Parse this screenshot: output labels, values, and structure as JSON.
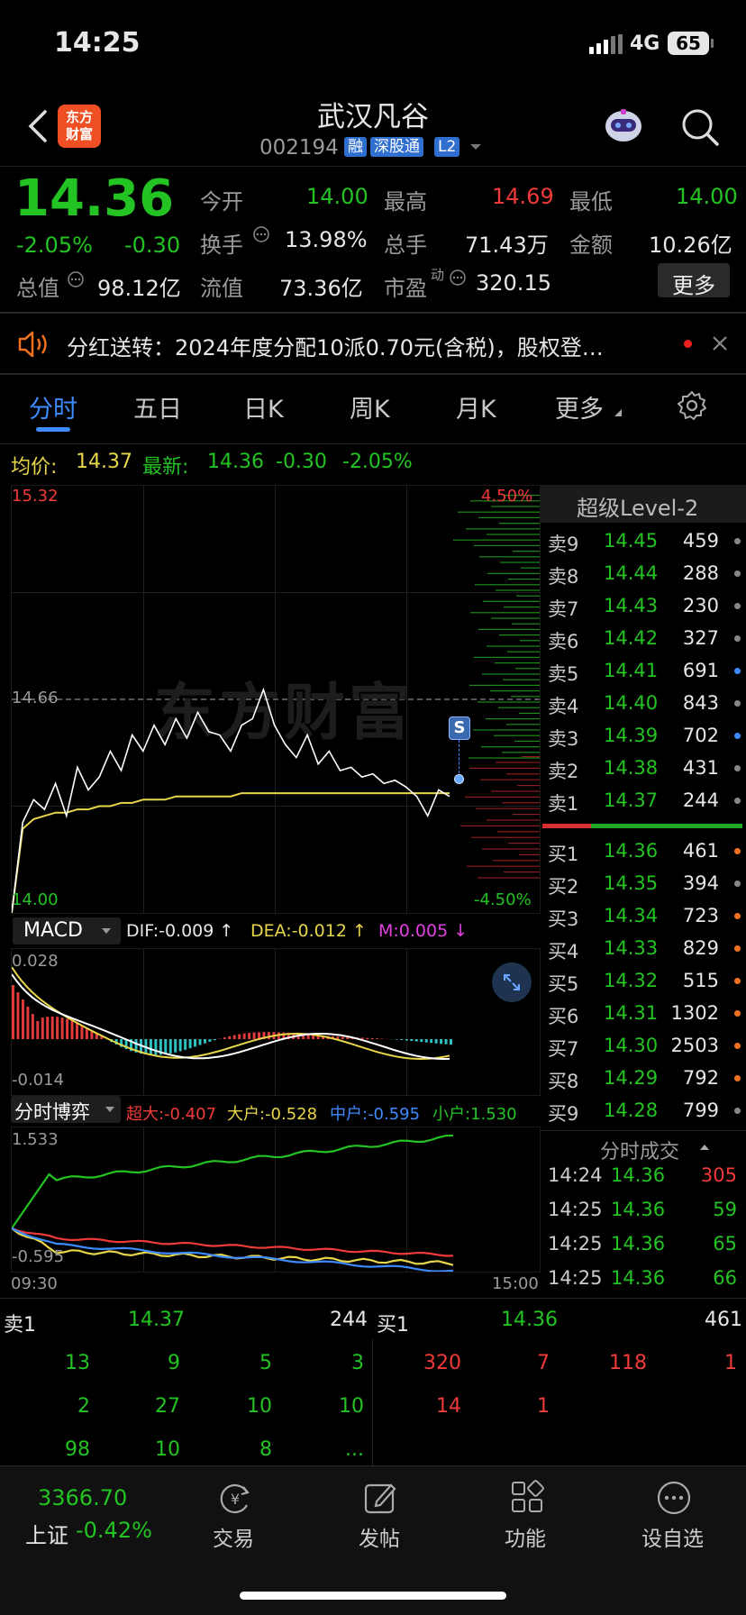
{
  "status_bar": {
    "time": "14:25",
    "network": "4G",
    "battery": "65"
  },
  "header": {
    "title": "武汉凡谷",
    "code": "002194",
    "badges": [
      "融",
      "深股通",
      "L2"
    ],
    "logo_text_1": "东方",
    "logo_text_2": "财富"
  },
  "quote": {
    "price": "14.36",
    "change_pct": "-2.05%",
    "change": "-0.30",
    "open_label": "今开",
    "open": "14.00",
    "high_label": "最高",
    "high": "14.69",
    "low_label": "最低",
    "low": "14.00",
    "turnover_label": "换手",
    "turnover": "13.98%",
    "volume_label": "总手",
    "volume": "71.43万",
    "amount_label": "金额",
    "amount": "10.26亿",
    "mktcap_label": "总值",
    "mktcap": "98.12亿",
    "float_label": "流值",
    "float": "73.36亿",
    "pe_label": "市盈",
    "pe_sup": "动",
    "pe": "320.15",
    "more_button": "更多"
  },
  "notice": {
    "text": "分红送转：2024年度分配10派0.70元(含税)，股权登…"
  },
  "tabs": [
    "分时",
    "五日",
    "日K",
    "周K",
    "月K",
    "更多"
  ],
  "info_line": {
    "avg_label": "均价:",
    "avg": "14.37",
    "latest_label": "最新:",
    "latest": "14.36",
    "change": "-0.30",
    "pct": "-2.05%"
  },
  "chart": {
    "y_top": "15.32",
    "y_mid": "14.66",
    "y_bottom": "14.00",
    "pct_top": "4.50%",
    "pct_bottom": "-4.50%",
    "marker": "S",
    "watermark": "东方财富",
    "time_start": "09:30",
    "time_end": "15:00"
  },
  "chart_data": {
    "type": "line",
    "series": [
      {
        "values": [
          14.0,
          14.28,
          14.35,
          14.32,
          14.4,
          14.3,
          14.45,
          14.38,
          14.42,
          14.5,
          14.44,
          14.55,
          14.5,
          14.58,
          14.52,
          14.6,
          14.54,
          14.62,
          14.56,
          14.55,
          14.5,
          14.58,
          14.6,
          14.69,
          14.58,
          14.52,
          14.48,
          14.55,
          14.46,
          14.5,
          14.44,
          14.45,
          14.42,
          14.43,
          14.4,
          14.41,
          14.39,
          14.36,
          14.3,
          14.38,
          14.36
        ]
      },
      {
        "values": [
          14.0,
          14.26,
          14.29,
          14.3,
          14.31,
          14.31,
          14.32,
          14.32,
          14.33,
          14.33,
          14.34,
          14.34,
          14.35,
          14.35,
          14.35,
          14.36,
          14.36,
          14.36,
          14.36,
          14.36,
          14.36,
          14.37,
          14.37,
          14.37,
          14.37,
          14.37,
          14.37,
          14.37,
          14.37,
          14.37,
          14.37,
          14.37,
          14.37,
          14.37,
          14.37,
          14.37,
          14.37,
          14.37,
          14.37,
          14.37,
          14.37
        ]
      }
    ],
    "x": [
      "09:30",
      "15:00"
    ],
    "ylim": [
      14.0,
      15.32
    ]
  },
  "macd": {
    "label": "MACD",
    "dif": "DIF:-0.009 ↑",
    "dea": "DEA:-0.012 ↑",
    "m": "M:0.005 ↓",
    "top": "0.028",
    "bottom": "-0.014"
  },
  "boyi": {
    "label": "分时博弈",
    "super": "超大:-0.407",
    "big": "大户:-0.528",
    "mid": "中户:-0.595",
    "small": "小户:1.530",
    "top": "1.533",
    "bottom": "-0.595"
  },
  "level2": {
    "title": "超级Level-2",
    "sells": [
      {
        "label": "卖9",
        "price": "14.45",
        "vol": "459",
        "dot": "#888888"
      },
      {
        "label": "卖8",
        "price": "14.44",
        "vol": "288",
        "dot": "#888888"
      },
      {
        "label": "卖7",
        "price": "14.43",
        "vol": "230",
        "dot": "#888888"
      },
      {
        "label": "卖6",
        "price": "14.42",
        "vol": "327",
        "dot": "#888888"
      },
      {
        "label": "卖5",
        "price": "14.41",
        "vol": "691",
        "dot": "#3d8bff"
      },
      {
        "label": "卖4",
        "price": "14.40",
        "vol": "843",
        "dot": "#888888"
      },
      {
        "label": "卖3",
        "price": "14.39",
        "vol": "702",
        "dot": "#3d8bff"
      },
      {
        "label": "卖2",
        "price": "14.38",
        "vol": "431",
        "dot": "#888888"
      },
      {
        "label": "卖1",
        "price": "14.37",
        "vol": "244",
        "dot": "#888888"
      }
    ],
    "buys": [
      {
        "label": "买1",
        "price": "14.36",
        "vol": "461",
        "dot": "#f07020"
      },
      {
        "label": "买2",
        "price": "14.35",
        "vol": "394",
        "dot": "#888888"
      },
      {
        "label": "买3",
        "price": "14.34",
        "vol": "723",
        "dot": "#f07020"
      },
      {
        "label": "买4",
        "price": "14.33",
        "vol": "829",
        "dot": "#f07020"
      },
      {
        "label": "买5",
        "price": "14.32",
        "vol": "515",
        "dot": "#f07020"
      },
      {
        "label": "买6",
        "price": "14.31",
        "vol": "1302",
        "dot": "#f07020"
      },
      {
        "label": "买7",
        "price": "14.30",
        "vol": "2503",
        "dot": "#f07020"
      },
      {
        "label": "买8",
        "price": "14.29",
        "vol": "792",
        "dot": "#f07020"
      },
      {
        "label": "买9",
        "price": "14.28",
        "vol": "799",
        "dot": "#888888"
      }
    ],
    "ticks_title": "分时成交",
    "ticks": [
      {
        "time": "14:24",
        "price": "14.36",
        "vol": "305",
        "color": "#f03a3a"
      },
      {
        "time": "14:25",
        "price": "14.36",
        "vol": "59",
        "color": "#23c323"
      },
      {
        "time": "14:25",
        "price": "14.36",
        "vol": "65",
        "color": "#23c323"
      },
      {
        "time": "14:25",
        "price": "14.36",
        "vol": "66",
        "color": "#23c323"
      }
    ]
  },
  "queue": {
    "sell_label": "卖1",
    "sell_price": "14.37",
    "sell_vol": "244",
    "buy_label": "买1",
    "buy_price": "14.36",
    "buy_vol": "461",
    "sell_rows": [
      [
        "13",
        "9",
        "5",
        "3"
      ],
      [
        "2",
        "27",
        "10",
        "10"
      ],
      [
        "98",
        "10",
        "8",
        "..."
      ]
    ],
    "buy_rows": [
      [
        "320",
        "7",
        "118",
        "1"
      ],
      [
        "14",
        "1"
      ]
    ]
  },
  "bottom_nav": {
    "index_value": "3366.70",
    "index_name": "上证",
    "index_pct": "-0.42%",
    "trade": "交易",
    "post": "发帖",
    "func": "功能",
    "watch": "设自选"
  }
}
